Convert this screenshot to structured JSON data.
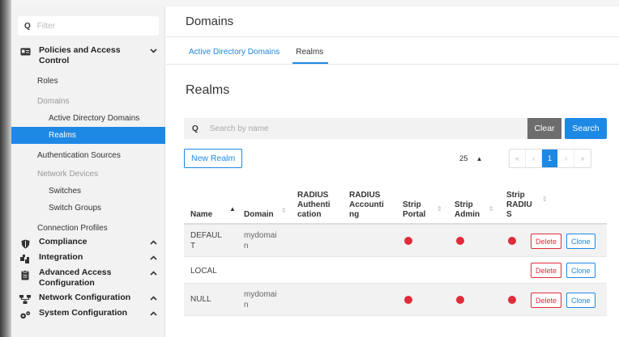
{
  "sidebar": {
    "filter_placeholder": "Filter",
    "sections": [
      {
        "label": "Policies and Access Control",
        "icon": "id-card-icon",
        "chevron": "v"
      },
      {
        "label": "Compliance",
        "icon": "shield-icon",
        "chevron": "^"
      },
      {
        "label": "Integration",
        "icon": "puzzle-icon",
        "chevron": "^"
      },
      {
        "label": "Advanced Access Configuration",
        "icon": "clipboard-icon",
        "chevron": "^"
      },
      {
        "label": "Network Configuration",
        "icon": "network-icon",
        "chevron": "^"
      },
      {
        "label": "System Configuration",
        "icon": "cogs-icon",
        "chevron": "^"
      }
    ],
    "items": {
      "roles": "Roles",
      "domains_group": "Domains",
      "active_directory_domains": "Active Directory Domains",
      "realms": "Realms",
      "authentication_sources": "Authentication Sources",
      "network_devices_group": "Network Devices",
      "switches": "Switches",
      "switch_groups": "Switch Groups",
      "connection_profiles": "Connection Profiles"
    }
  },
  "main": {
    "title": "Domains",
    "tabs": [
      {
        "label": "Active Directory Domains",
        "active": false
      },
      {
        "label": "Realms",
        "active": true
      }
    ],
    "section_title": "Realms",
    "search": {
      "placeholder": "Search by name",
      "clear_label": "Clear",
      "search_label": "Search"
    },
    "new_button": "New Realm",
    "per_page": "25",
    "pagination": {
      "first": "«",
      "prev": "‹",
      "current": "1",
      "next": "›",
      "last": "»"
    },
    "table": {
      "headers": {
        "name": "Name",
        "domain": "Domain",
        "radius_auth": [
          "RADIUS",
          "Authenti",
          "cation"
        ],
        "radius_acct": [
          "RADIUS",
          "Accounti",
          "ng"
        ],
        "strip_portal": [
          "Strip",
          "Portal"
        ],
        "strip_admin": [
          "Strip",
          "Admin"
        ],
        "strip_radius": [
          "Strip",
          "RADIU",
          "S"
        ]
      },
      "rows": [
        {
          "name": [
            "DEFAUL",
            "T"
          ],
          "domain": [
            "mydomai",
            "n"
          ],
          "strip_portal": true,
          "strip_admin": true,
          "strip_radius": true
        },
        {
          "name": [
            "LOCAL"
          ],
          "domain": [],
          "strip_portal": false,
          "strip_admin": false,
          "strip_radius": false
        },
        {
          "name": [
            "NULL"
          ],
          "domain": [
            "mydomai",
            "n"
          ],
          "strip_portal": true,
          "strip_admin": true,
          "strip_radius": true
        }
      ],
      "delete_label": "Delete",
      "clone_label": "Clone"
    }
  },
  "colors": {
    "accent": "#1e88e5",
    "danger": "#e12b3a",
    "clear_button": "#6d6d6d"
  }
}
